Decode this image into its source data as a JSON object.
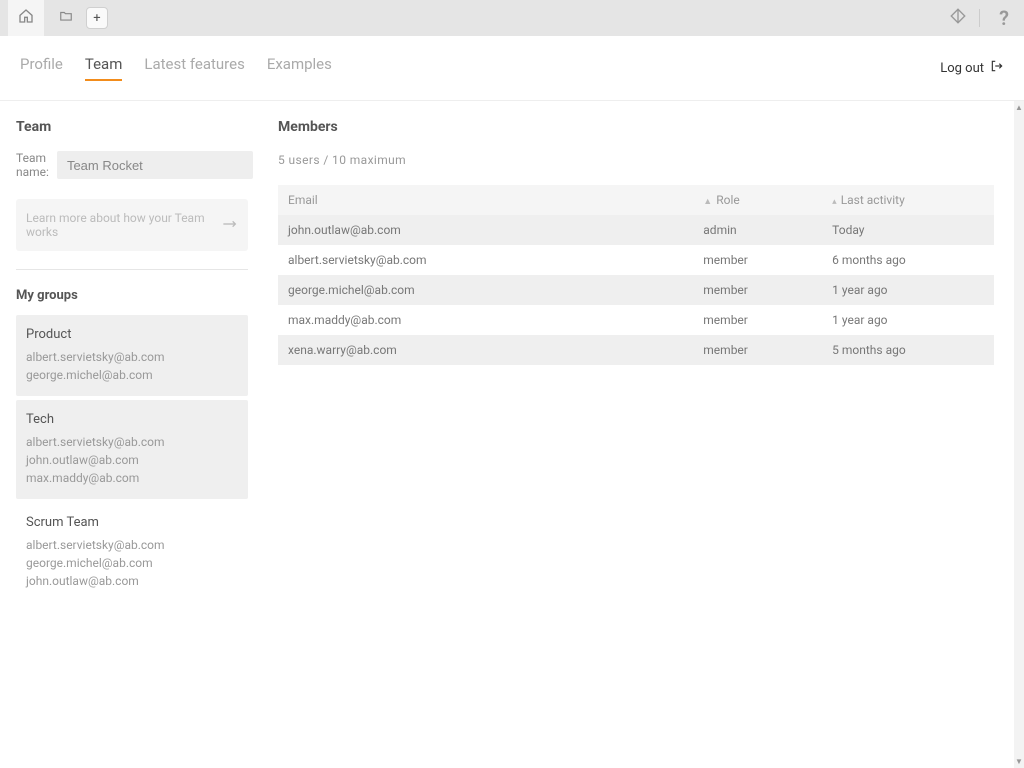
{
  "topbar": {
    "plus_label": "+",
    "help_label": "?"
  },
  "nav": {
    "tabs": [
      {
        "label": "Profile",
        "active": false
      },
      {
        "label": "Team",
        "active": true
      },
      {
        "label": "Latest features",
        "active": false
      },
      {
        "label": "Examples",
        "active": false
      }
    ],
    "logout_label": "Log out"
  },
  "sidebar": {
    "team_heading": "Team",
    "team_name_label": "Team name:",
    "team_name_value": "Team Rocket",
    "learn_more": "Learn more about how your Team works",
    "groups_heading": "My groups",
    "groups": [
      {
        "name": "Product",
        "alt": true,
        "members": [
          "albert.servietsky@ab.com",
          "george.michel@ab.com"
        ]
      },
      {
        "name": "Tech",
        "alt": true,
        "members": [
          "albert.servietsky@ab.com",
          "john.outlaw@ab.com",
          "max.maddy@ab.com"
        ]
      },
      {
        "name": "Scrum Team",
        "alt": false,
        "members": [
          "albert.servietsky@ab.com",
          "george.michel@ab.com",
          "john.outlaw@ab.com"
        ]
      }
    ]
  },
  "content": {
    "heading": "Members",
    "counts_text": "5 users / 10 maximum",
    "columns": {
      "email": "Email",
      "role": "Role",
      "activity": "Last activity"
    },
    "rows": [
      {
        "email": "john.outlaw@ab.com",
        "role": "admin",
        "activity": "Today"
      },
      {
        "email": "albert.servietsky@ab.com",
        "role": "member",
        "activity": "6 months ago"
      },
      {
        "email": "george.michel@ab.com",
        "role": "member",
        "activity": "1 year ago"
      },
      {
        "email": "max.maddy@ab.com",
        "role": "member",
        "activity": "1 year ago"
      },
      {
        "email": "xena.warry@ab.com",
        "role": "member",
        "activity": "5 months ago"
      }
    ]
  }
}
